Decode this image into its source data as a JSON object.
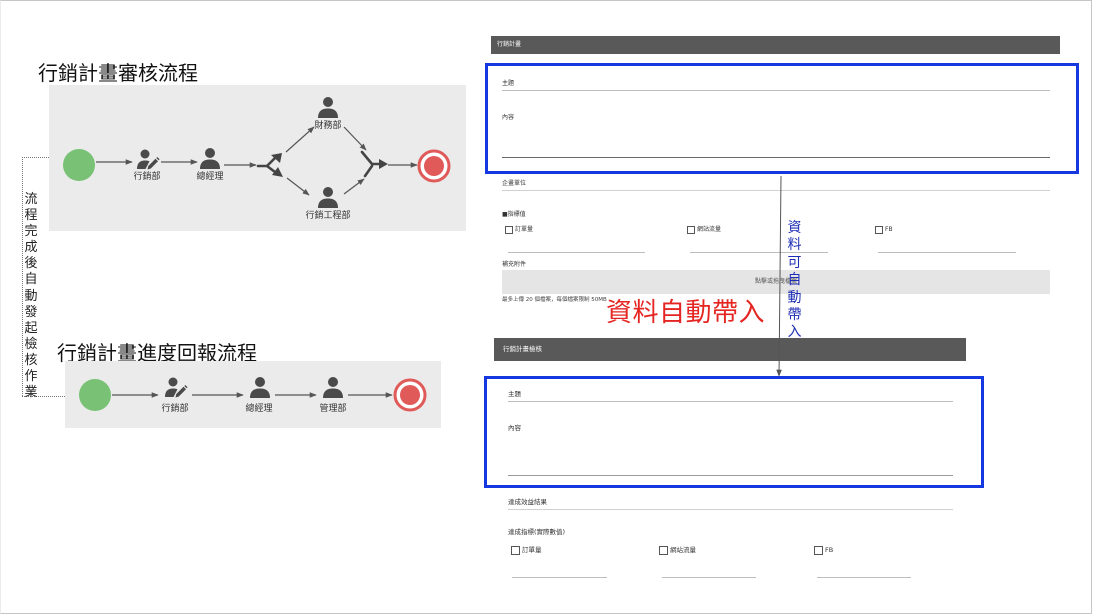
{
  "colors": {
    "start_event": "#78c175",
    "end_event": "#e05a5a",
    "highlight_frame": "#1538e0",
    "callout_red": "#e52521",
    "callout_blue": "#1f2fb5",
    "panel_bg": "#ebebeb",
    "form_header_bg": "#595959",
    "icon": "#4a4a4a"
  },
  "approval_flow": {
    "title": "行銷計畫審核流程",
    "start_icon": "start-event-icon",
    "end_icon": "end-event-icon",
    "split_gateway_icon": "parallel-split-icon",
    "merge_gateway_icon": "parallel-merge-icon",
    "steps": [
      {
        "label": "行銷部",
        "icon": "person-edit-icon"
      },
      {
        "label": "總經理",
        "icon": "person-icon"
      },
      {
        "label": "財務部",
        "icon": "person-icon"
      },
      {
        "label": "行銷工程部",
        "icon": "person-icon"
      }
    ]
  },
  "progress_flow": {
    "title": "行銷計畫進度回報流程",
    "start_icon": "start-event-icon",
    "end_icon": "end-event-icon",
    "steps": [
      {
        "label": "行銷部",
        "icon": "person-edit-icon"
      },
      {
        "label": "總經理",
        "icon": "person-icon"
      },
      {
        "label": "管理部",
        "icon": "person-icon"
      }
    ]
  },
  "trigger_note": "流程完成後自動發起檢核作業",
  "plan_form": {
    "header": "行銷計畫",
    "subject_label": "主題",
    "content_label": "內容",
    "unit_label": "企畫單位",
    "indicator_label": "■指標值",
    "indicators": [
      "訂單量",
      "網站流量",
      "FB"
    ],
    "attachment_label": "補充附件",
    "upload_hint": "點擊或拖曳檔案",
    "upload_note": "最多上傳 20 個檔案，每個檔案限制 50MB"
  },
  "review_form": {
    "header": "行銷計畫檢核",
    "subject_label": "主題",
    "content_label": "內容",
    "result_label": "達成效益結果",
    "indicator_label": "達成指標(實際數值)",
    "indicators": [
      "訂單量",
      "網站流量",
      "FB"
    ]
  },
  "callouts": {
    "red": "資料自動帶入",
    "blue": "資料可自動帶入"
  }
}
